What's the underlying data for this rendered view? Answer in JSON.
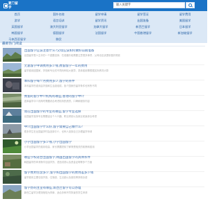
{
  "site": {
    "logo_text": "夏门留学",
    "search_placeholder": "输入关键字"
  },
  "nav": [
    "首页",
    "国外名校",
    "留学申请",
    "留学签证",
    "留学费用",
    "游学",
    "语言培训",
    "留学资讯",
    "出国准备",
    "美国留学",
    "英国留学",
    "澳大利亚留学",
    "加拿大留学",
    "新西兰留学",
    "日本留学",
    "韩国留学",
    "德国留学",
    "法国留学",
    "中国香港留学",
    "新加坡留学",
    "马来西亚留学",
    "移民"
  ],
  "section": {
    "title": "最新热门阅读"
  },
  "articles": [
    {
      "title": "出国留学应该注意什么?父母应该如何做好前期准备",
      "summary": "出国留学是人生中的一个重要选择，在准备阶段需要注意很多事项，父母也应该提前做好规划"
    },
    {
      "title": "元富留学申请费用多少钱,费留留学一年的费用",
      "summary": "留学费用因国家、学校和专业的不同而有较大差异，具体费用需根据实际情况计算"
    },
    {
      "title": "本科留学每个月费用多少,留学的条件",
      "summary": "本科留学的费用由学费和生活费组成，各个国家的留学条件也有所不同"
    },
    {
      "title": "费留的留学中介机构有哪些,香港的留学中介",
      "summary": "选择留学中介机构时需要综合考虑机构的资质、口碑和服务内容"
    },
    {
      "title": "现在出国留学的专业有哪些,留学专业选择",
      "summary": "出国留学选择专业需要结合个人兴趣、职业规划以及就业前景综合考虑"
    },
    {
      "title": "中介出国留学什么好,留学需要自己做什么?",
      "summary": "很多学生在出国留学时会选择中介，也有人选择自己办理留学申请"
    },
    {
      "title": "小学出国留学多少钱,小学出国留学",
      "summary": "小学出国留学的费用较高，家长需要提前了解清楚相关的政策和费用"
    },
    {
      "title": "哪些学校适合出国留学,韩国出国留学的具体条件",
      "summary": "韩国留学的申请条件包括学历、语言成绩以及资金证明等多个方面"
    },
    {
      "title": "留学费用包含多少,留学和出国留学的费用差多少钱",
      "summary": "留学费用主要包括学费、住宿费、生活费以及保险等其他杂费"
    },
    {
      "title": "留学办的主业有哪些,新西兰留学可以办理",
      "summary": "新西兰留学办理流程较为简单，适合多种不同背景的学生申请"
    }
  ],
  "colors": {
    "header": "#1a73c6",
    "nav_bg": "#dbe8f6",
    "link": "#2b65a7"
  }
}
